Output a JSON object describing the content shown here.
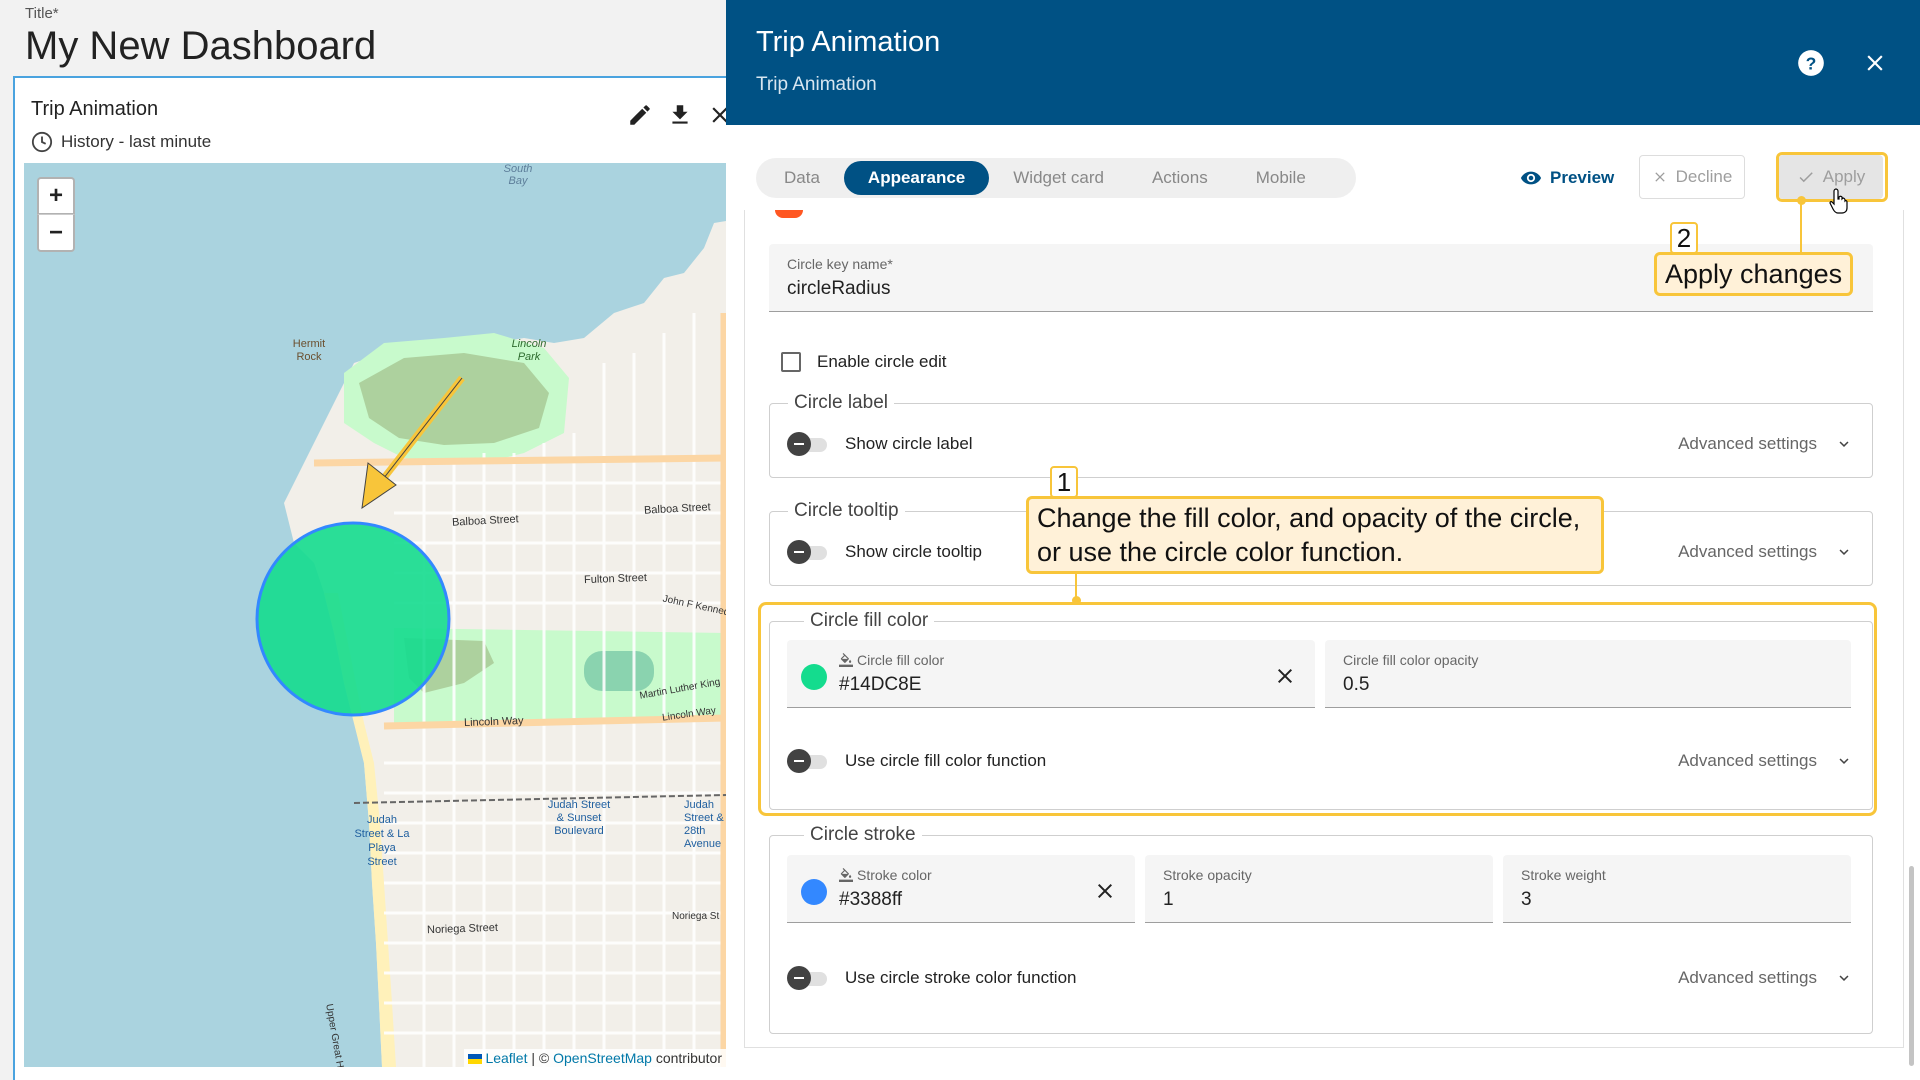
{
  "dashboard": {
    "title_label": "Title*",
    "title": "My New Dashboard"
  },
  "widget": {
    "title": "Trip Animation",
    "history": "History - last minute",
    "icons": [
      "edit-icon",
      "download-icon",
      "close-icon"
    ]
  },
  "map": {
    "zoom_in": "+",
    "zoom_out": "−",
    "attribution": {
      "leaflet": "Leaflet",
      "separator": " | © ",
      "osm": "OpenStreetMap",
      "suffix": " contributor"
    },
    "labels": {
      "south_bay": "South Bay",
      "hermit_rock": "Hermit Rock",
      "lincoln_park": "Lincoln Park",
      "balboa_1": "Balboa Street",
      "balboa_2": "Balboa Street",
      "fulton": "Fulton Street",
      "jfk": "John F Kennedy",
      "mlk": "Martin Luther King",
      "lincoln_way_1": "Lincoln Way",
      "lincoln_way_2": "Lincoln Way",
      "judah_playa": "Judah Street & La Playa Street",
      "judah_sunset": "Judah Street & Sunset Boulevard",
      "judah_28th": "Judah Street & 28th Avenue",
      "noriega_1": "Noriega Street",
      "noriega_2": "Noriega St",
      "great_highway": "Upper Great Highway"
    },
    "circle_fill": "#14DC8E",
    "circle_stroke": "#3388ff",
    "water_color": "#aad3df",
    "land_color": "#f2efe9"
  },
  "panel": {
    "title": "Trip Animation",
    "subtitle": "Trip Animation",
    "tabs": [
      {
        "label": "Data",
        "active": false
      },
      {
        "label": "Appearance",
        "active": true
      },
      {
        "label": "Widget card",
        "active": false
      },
      {
        "label": "Actions",
        "active": false
      },
      {
        "label": "Mobile",
        "active": false
      }
    ],
    "preview_label": "Preview",
    "decline_label": "Decline",
    "apply_label": "Apply",
    "header_color": "#005184",
    "fields": {
      "circle_key": {
        "label": "Circle key name*",
        "value": "circleRadius"
      },
      "enable_edit": {
        "label": "Enable circle edit",
        "checked": false
      }
    },
    "groups": {
      "circle_label": {
        "legend": "Circle label",
        "toggle": "Show circle label",
        "advanced": "Advanced settings"
      },
      "circle_tooltip": {
        "legend": "Circle tooltip",
        "toggle": "Show circle tooltip",
        "advanced": "Advanced settings"
      },
      "circle_fill": {
        "legend": "Circle fill color",
        "color_label": "Circle fill color",
        "color_value": "#14DC8E",
        "opacity_label": "Circle fill color opacity",
        "opacity_value": "0.5",
        "toggle": "Use circle fill color function",
        "advanced": "Advanced settings"
      },
      "circle_stroke": {
        "legend": "Circle stroke",
        "color_label": "Stroke color",
        "color_value": "#3388ff",
        "opacity_label": "Stroke opacity",
        "opacity_value": "1",
        "weight_label": "Stroke weight",
        "weight_value": "3",
        "toggle": "Use circle stroke color function",
        "advanced": "Advanced settings"
      }
    }
  },
  "callouts": {
    "one": {
      "number": "1",
      "line1": "Change the fill color, and opacity of the circle,",
      "line2": "or use the circle color function."
    },
    "two": {
      "number": "2",
      "text": "Apply changes"
    },
    "accent": "#f8c53a"
  }
}
